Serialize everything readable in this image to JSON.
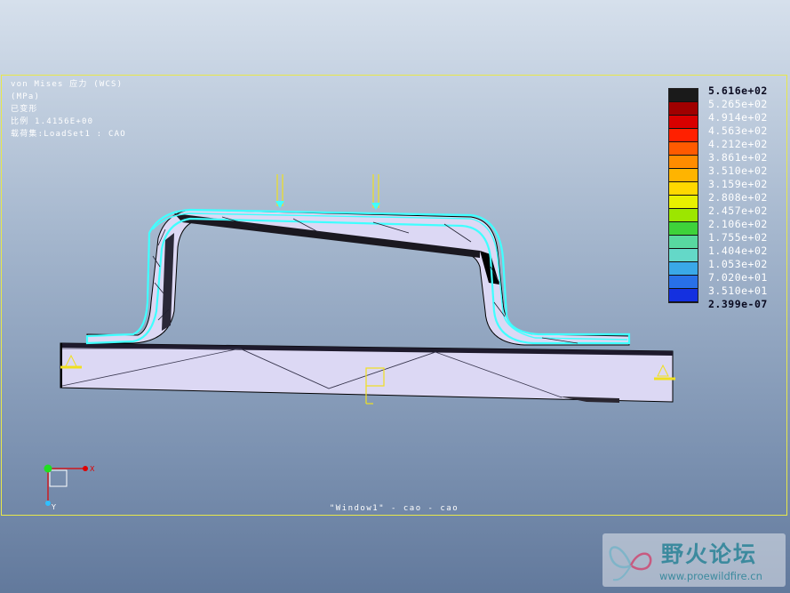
{
  "viewport": {
    "info": {
      "line1": "von Mises 应力 (WCS)",
      "line2": "(MPa)",
      "line3": "已变形",
      "line4": "比例  1.4156E+00",
      "line5": "载荷集:LoadSet1 :  CAO"
    },
    "caption": "\"Window1\" - cao - cao"
  },
  "legend": {
    "labels": [
      "5.616e+02",
      "5.265e+02",
      "4.914e+02",
      "4.563e+02",
      "4.212e+02",
      "3.861e+02",
      "3.510e+02",
      "3.159e+02",
      "2.808e+02",
      "2.457e+02",
      "2.106e+02",
      "1.755e+02",
      "1.404e+02",
      "1.053e+02",
      "7.020e+01",
      "3.510e+01",
      "2.399e-07"
    ],
    "colors": [
      "#1a1a1a",
      "#a00000",
      "#d80000",
      "#ff2000",
      "#ff5a00",
      "#ff8c00",
      "#ffb400",
      "#ffd800",
      "#e8f000",
      "#9ce600",
      "#3ed23a",
      "#58d8a0",
      "#64d8c8",
      "#3aa8e8",
      "#2870e8",
      "#1430e0"
    ]
  },
  "triad": {
    "x_label": "X",
    "y_label": "Y"
  },
  "colors": {
    "frame": "#e8e84a",
    "part": "#dcd8f4",
    "mesh": "#40ffff",
    "edge": "#000000",
    "constraint": "#f0e020"
  },
  "watermark": {
    "title": "野火论坛",
    "url": "www.proewildfire.cn"
  }
}
